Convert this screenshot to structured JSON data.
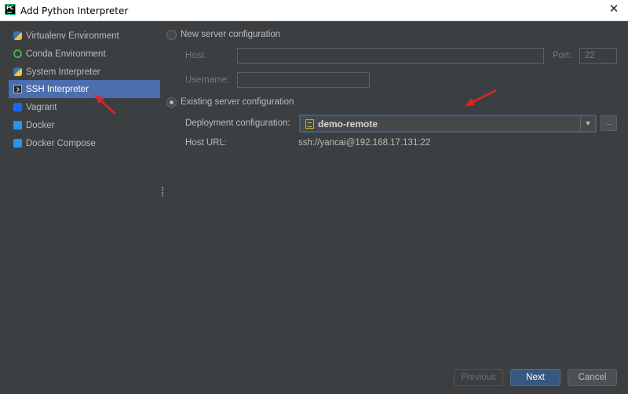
{
  "window": {
    "title": "Add Python Interpreter",
    "app_icon_text": "PC"
  },
  "sidebar": {
    "items": [
      {
        "label": "Virtualenv Environment",
        "icon": "virtualenv-icon",
        "selected": false
      },
      {
        "label": "Conda Environment",
        "icon": "conda-icon",
        "selected": false
      },
      {
        "label": "System Interpreter",
        "icon": "python-icon",
        "selected": false
      },
      {
        "label": "SSH Interpreter",
        "icon": "ssh-terminal-icon",
        "selected": true
      },
      {
        "label": "Vagrant",
        "icon": "vagrant-icon",
        "selected": false
      },
      {
        "label": "Docker",
        "icon": "docker-icon",
        "selected": false
      },
      {
        "label": "Docker Compose",
        "icon": "docker-compose-icon",
        "selected": false
      }
    ]
  },
  "main": {
    "new_server": {
      "label": "New server configuration",
      "selected": false,
      "host_label": "Host:",
      "host_value": "",
      "port_label": "Port:",
      "port_value": "22",
      "username_label": "Username:",
      "username_value": ""
    },
    "existing_server": {
      "label": "Existing server configuration",
      "selected": true,
      "deployment_label": "Deployment configuration:",
      "deployment_value": "demo-remote",
      "more_button": "...",
      "host_url_label": "Host URL:",
      "host_url_value": "ssh://yancai@192.168.17.131:22"
    }
  },
  "buttons": {
    "previous": "Previous",
    "next": "Next",
    "cancel": "Cancel"
  },
  "colors": {
    "background": "#3c3f41",
    "selection": "#4b6eaf",
    "primary_button": "#365880",
    "annotation_arrow": "#e02424"
  }
}
